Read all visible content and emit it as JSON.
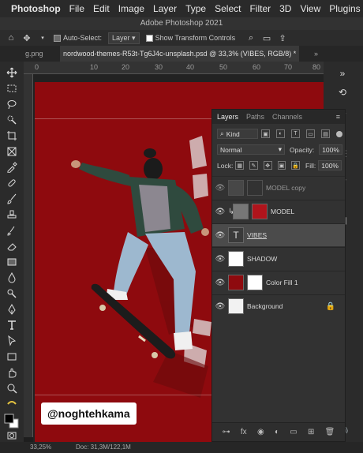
{
  "menubar": {
    "app": "Photoshop",
    "items": [
      "File",
      "Edit",
      "Image",
      "Layer",
      "Type",
      "Select",
      "Filter",
      "3D",
      "View",
      "Plugins"
    ]
  },
  "titlebar": {
    "title": "Adobe Photoshop 2021"
  },
  "options": {
    "auto_select_label": "Auto-Select:",
    "auto_select_value": "Layer",
    "transform_label": "Show Transform Controls"
  },
  "tabs": {
    "prev": "g.png",
    "active": "nordwood-themes-R53t-Tg6J4c-unsplash.psd @ 33,3% (VIBES, RGB/8) *",
    "more": "»"
  },
  "ruler": {
    "ticks": [
      "0",
      "10",
      "20",
      "30",
      "40",
      "50",
      "60",
      "70",
      "80"
    ]
  },
  "layers_panel": {
    "tabs": [
      "Layers",
      "Paths",
      "Channels"
    ],
    "kind_label": "Kind",
    "blend_mode": "Normal",
    "opacity_label": "Opacity:",
    "opacity_value": "100%",
    "lock_label": "Lock:",
    "fill_label": "Fill:",
    "fill_value": "100%",
    "layers": [
      {
        "name": "MODEL copy"
      },
      {
        "name": "MODEL"
      },
      {
        "name": "VIBES"
      },
      {
        "name": "SHADOW"
      },
      {
        "name": "Color Fill 1"
      },
      {
        "name": "Background"
      }
    ]
  },
  "watermark": "@noghtehkama",
  "status": {
    "zoom": "33,25%",
    "doc": "Doc: 31,3M/122,1M"
  }
}
